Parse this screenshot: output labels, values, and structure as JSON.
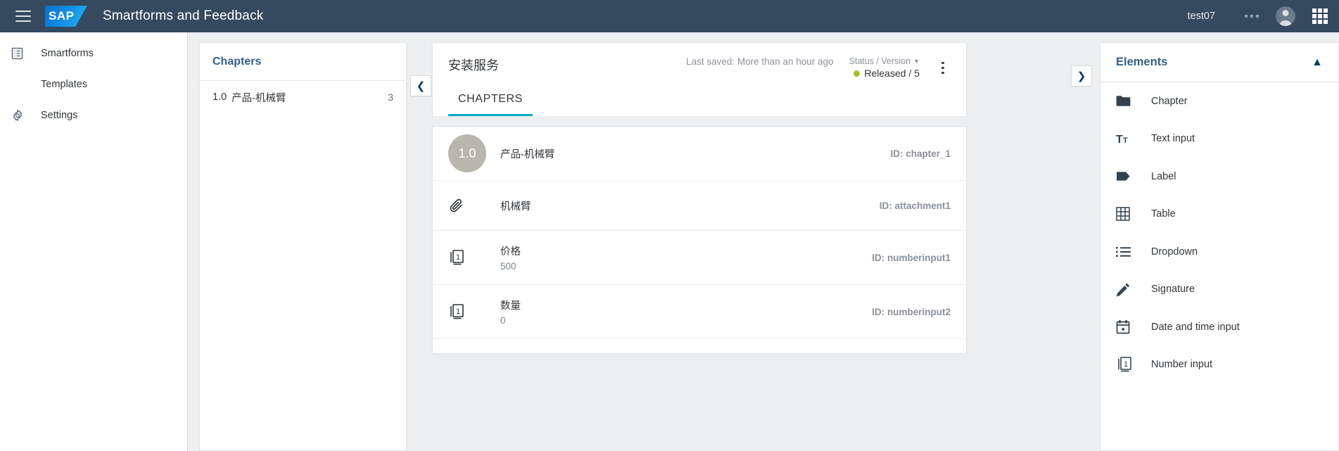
{
  "shellbar": {
    "menu_icon": "hamburger-menu-icon",
    "logo_text": "SAP",
    "title": "Smartforms and Feedback",
    "user": "test07",
    "overflow_icon": "more-horizontal-icon",
    "avatar_icon": "user-avatar-icon",
    "apps_icon": "app-grid-icon"
  },
  "sidebar": {
    "items": [
      {
        "label": "Smartforms",
        "icon": "form-list-icon",
        "sub": false
      },
      {
        "label": "Templates",
        "icon": "",
        "sub": true
      },
      {
        "label": "Settings",
        "icon": "gear-icon",
        "sub": false
      }
    ]
  },
  "chapters_panel": {
    "title": "Chapters",
    "collapse_icon": "chevron-left-icon",
    "rows": [
      {
        "index": "1.0",
        "name": "产品-机械臂",
        "count": "3"
      }
    ]
  },
  "editor": {
    "title": "安装服务",
    "last_saved": "Last saved: More than an hour ago",
    "status_label": "Status / Version",
    "status_chevron": "chevron-down-icon",
    "status_value": "Released / 5",
    "status_color": "#aabb28",
    "overflow_icon": "more-vertical-icon",
    "tabs": [
      {
        "label": "CHAPTERS",
        "active": true
      }
    ],
    "tab_accent": "#09acc9",
    "rows": [
      {
        "kind": "chapter",
        "badge": "1.0",
        "label": "产品-机械臂",
        "value": "",
        "id": "ID: chapter_1",
        "icon": "chapter-circle-icon"
      },
      {
        "kind": "attachment",
        "badge": "",
        "label": "机械臂",
        "value": "",
        "id": "ID: attachment1",
        "icon": "paperclip-icon"
      },
      {
        "kind": "number",
        "badge": "",
        "label": "价格",
        "value": "500",
        "id": "ID: numberinput1",
        "icon": "number-input-icon"
      },
      {
        "kind": "number",
        "badge": "",
        "label": "数量",
        "value": "0",
        "id": "ID: numberinput2",
        "icon": "number-input-icon"
      }
    ]
  },
  "elements_panel": {
    "expand_icon": "chevron-right-icon",
    "title": "Elements",
    "collapse_icon": "chevron-up-icon",
    "items": [
      {
        "label": "Chapter",
        "icon": "folder-icon"
      },
      {
        "label": "Text input",
        "icon": "text-input-icon"
      },
      {
        "label": "Label",
        "icon": "tag-label-icon"
      },
      {
        "label": "Table",
        "icon": "table-grid-icon"
      },
      {
        "label": "Dropdown",
        "icon": "list-dropdown-icon"
      },
      {
        "label": "Signature",
        "icon": "pencil-icon"
      },
      {
        "label": "Date and time input",
        "icon": "calendar-icon"
      },
      {
        "label": "Number input",
        "icon": "number-input-icon"
      }
    ]
  }
}
